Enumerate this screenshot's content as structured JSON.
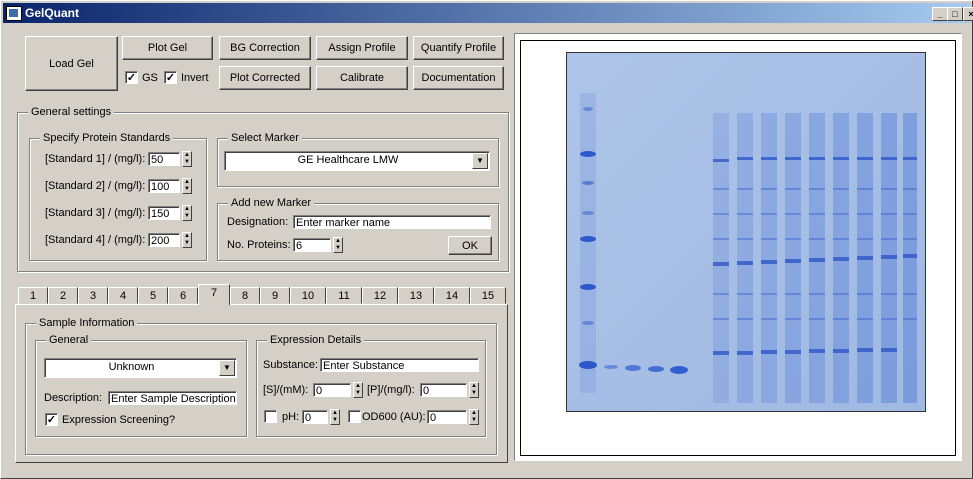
{
  "window": {
    "title": "GelQuant",
    "min": "_",
    "max": "□",
    "close": "×"
  },
  "toolbar": {
    "load_gel": "Load Gel",
    "plot_gel": "Plot Gel",
    "bg_correction": "BG Correction",
    "assign_profile": "Assign Profile",
    "quantify_profile": "Quantify Profile",
    "gs_label": "GS",
    "gs_checked": true,
    "invert_label": "Invert",
    "invert_checked": true,
    "plot_corrected": "Plot Corrected",
    "calibrate": "Calibrate",
    "documentation": "Documentation"
  },
  "general_settings": {
    "title": "General settings",
    "standards": {
      "title": "Specify Protein Standards",
      "items": [
        {
          "label": "[Standard 1] / (mg/l):",
          "value": "50"
        },
        {
          "label": "[Standard 2] / (mg/l):",
          "value": "100"
        },
        {
          "label": "[Standard 3] / (mg/l):",
          "value": "150"
        },
        {
          "label": "[Standard 4] / (mg/l):",
          "value": "200"
        }
      ]
    },
    "select_marker": {
      "title": "Select Marker",
      "selected": "GE Healthcare LMW"
    },
    "add_marker": {
      "title": "Add new Marker",
      "designation_label": "Designation:",
      "designation_value": "Enter marker name",
      "proteins_label": "No. Proteins:",
      "proteins_value": "6",
      "ok": "OK"
    }
  },
  "tabs": [
    "1",
    "2",
    "3",
    "4",
    "5",
    "6",
    "7",
    "8",
    "9",
    "10",
    "11",
    "12",
    "13",
    "14",
    "15"
  ],
  "active_tab": "7",
  "sample_info": {
    "title": "Sample Information",
    "general": {
      "title": "General",
      "selected": "Unknown",
      "description_label": "Description:",
      "description_value": "Enter Sample Description",
      "screening_label": "Expression Screening?",
      "screening_checked": true
    },
    "expression": {
      "title": "Expression Details",
      "substance_label": "Substance:",
      "substance_value": "Enter Substance",
      "s_label": "[S]/(mM):",
      "s_value": "0",
      "p_label": "[P]/(mg/l):",
      "p_value": "0",
      "ph_label": "pH:",
      "ph_value": "0",
      "od_label": "OD600 (AU):",
      "od_value": "0"
    }
  }
}
